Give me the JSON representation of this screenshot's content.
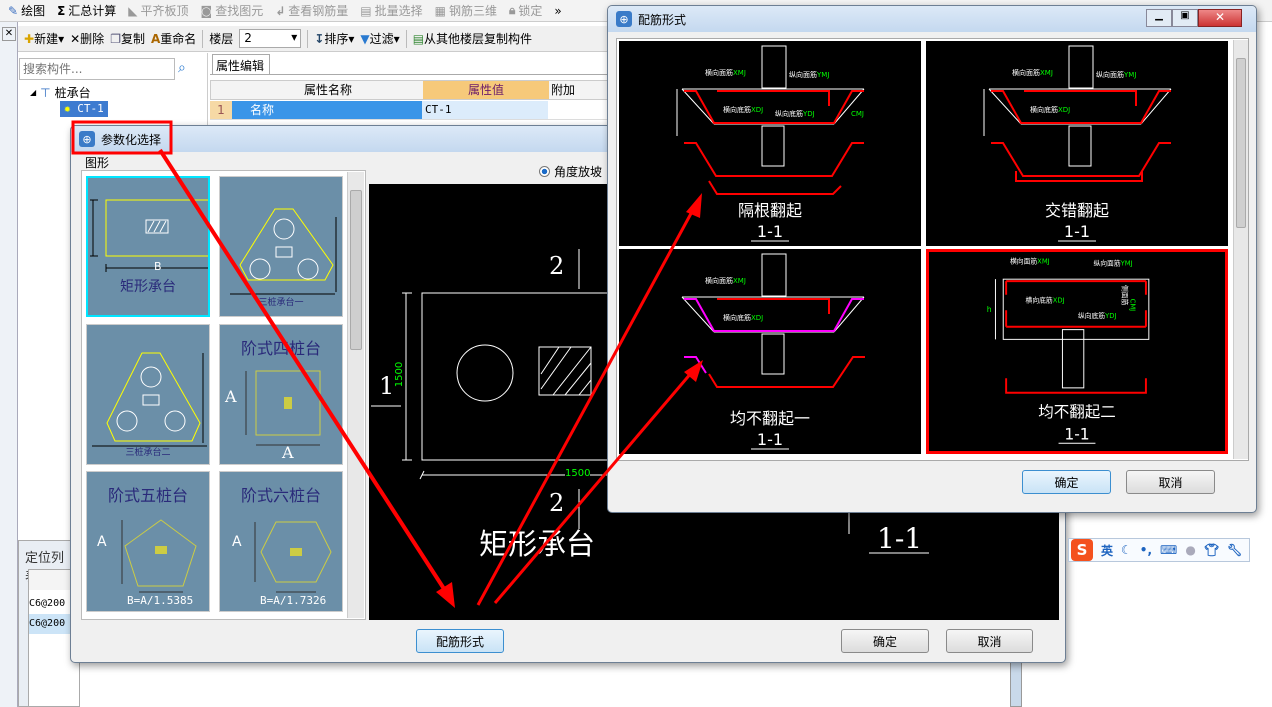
{
  "toolbar1": {
    "items": [
      {
        "label": "绘图",
        "icon": "draw-icon"
      },
      {
        "label": "汇总计算",
        "icon": "sigma-icon"
      },
      {
        "label": "平齐板顶",
        "icon": "align-icon"
      },
      {
        "label": "查找图元",
        "icon": "binoculars-icon"
      },
      {
        "label": "查看钢筋量",
        "icon": "view-icon"
      },
      {
        "label": "批量选择",
        "icon": "batch-icon"
      },
      {
        "label": "钢筋三维",
        "icon": "3d-icon"
      },
      {
        "label": "锁定",
        "icon": "lock-icon"
      }
    ],
    "more": "»"
  },
  "toolbar2": {
    "new": "新建",
    "delete": "删除",
    "copy": "复制",
    "rename": "重命名",
    "floor_label": "楼层",
    "floor_value": "2",
    "sort": "排序",
    "filter": "过滤",
    "copy_from": "从其他楼层复制构件"
  },
  "left": {
    "search_placeholder": "搜索构件...",
    "tree_root": "桩承台",
    "tree_child": "CT-1"
  },
  "props": {
    "tab": "属性编辑",
    "headers": [
      "属性名称",
      "属性值",
      "附加"
    ],
    "rows": [
      {
        "num": "1",
        "name": "名称",
        "value": "CT-1"
      }
    ]
  },
  "loclist": {
    "title": "定位列表",
    "rows": [
      "C6@200",
      "C6@200"
    ]
  },
  "param": {
    "title": "参数化选择",
    "group": "图形",
    "radio": "角度放坡",
    "shapes": [
      {
        "label": "矩形承台",
        "dim": "B"
      },
      {
        "label": "三桩承台一"
      },
      {
        "label": "三桩承台二"
      },
      {
        "label": "阶式四桩台",
        "dim": "A"
      },
      {
        "label": "阶式五桩台",
        "dim": "A",
        "formula": "B=A/1.5385"
      },
      {
        "label": "阶式六桩台",
        "dim": "A",
        "formula": "B=A/1.7326"
      }
    ],
    "preview": {
      "sec1": "1",
      "sec2": "2",
      "dim_v": "1500",
      "dim_h": "1500",
      "name": "矩形承台",
      "section": "1-1"
    },
    "btn_rebar": "配筋形式",
    "ok": "确定",
    "cancel": "取消"
  },
  "rebar": {
    "title": "配筋形式",
    "options": [
      {
        "label": "隔根翻起",
        "section": "1-1"
      },
      {
        "label": "交错翻起",
        "section": "1-1"
      },
      {
        "label": "均不翻起一",
        "section": "1-1"
      },
      {
        "label": "均不翻起二",
        "section": "1-1",
        "selected": true
      }
    ],
    "labels": {
      "xm": "横向面筋",
      "xm_code": "XMJ",
      "ym": "纵向面筋",
      "ym_code": "YMJ",
      "xd": "横向底筋",
      "xd_code": "XDJ",
      "yd": "纵向底筋",
      "yd_code": "YDJ",
      "side": "侧面筋",
      "side_code": "CMJ",
      "h": "h"
    },
    "ok": "确定",
    "cancel": "取消"
  },
  "ime": {
    "logo": "S",
    "lang": "英"
  },
  "colors": {
    "cad_red": "#ff0000",
    "cad_green": "#00ff00",
    "thumb_bg": "#6b8fa8",
    "annot": "#ff0000"
  }
}
